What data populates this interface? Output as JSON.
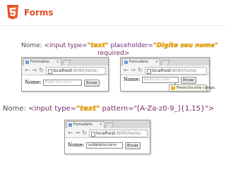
{
  "header": {
    "title": "Forms",
    "logo_color": "#e44d26"
  },
  "example1": {
    "label": "Nome:",
    "tag": "<input",
    "type_attr": "type=",
    "type_val": "\"text\"",
    "placeholder_attr": "placeholder=",
    "placeholder_val": "\"Digite seu nome\"",
    "required": "required>"
  },
  "example2": {
    "label": "Nome:",
    "tag": "<input",
    "type_attr": "type=",
    "type_val": "\"text\"",
    "pattern": "pattern=\"[A-Za-z0-9_]{1,15}\">"
  },
  "browser1": {
    "tab_title": "Formulário",
    "tab_close": "×",
    "address_host": "localhost",
    "address_path": ":8080/teste/",
    "field_label": "Nome:",
    "field_placeholder": "Digite seu nome",
    "button_label": "Enviar"
  },
  "browser2": {
    "tab_title": "Formulário",
    "tab_close": "×",
    "address_host": "localhost",
    "address_path": ":8080/teste/",
    "field_label": "Nome:",
    "field_placeholder": "Digite seu nome",
    "button_label": "Enviar",
    "tooltip": "Preencha este campo."
  },
  "browser3": {
    "tab_title": "Formulário",
    "tab_close": "×",
    "address_host": "localhost",
    "address_path": ":8080/teste/",
    "field_label": "Nome:",
    "field_value": "asdfghjklzxcvbnm",
    "button_label": "Enviar"
  },
  "colors": {
    "accent": "#e44d26",
    "attribute_value": "#e7a100",
    "code_keyword": "#7a2a5a"
  }
}
